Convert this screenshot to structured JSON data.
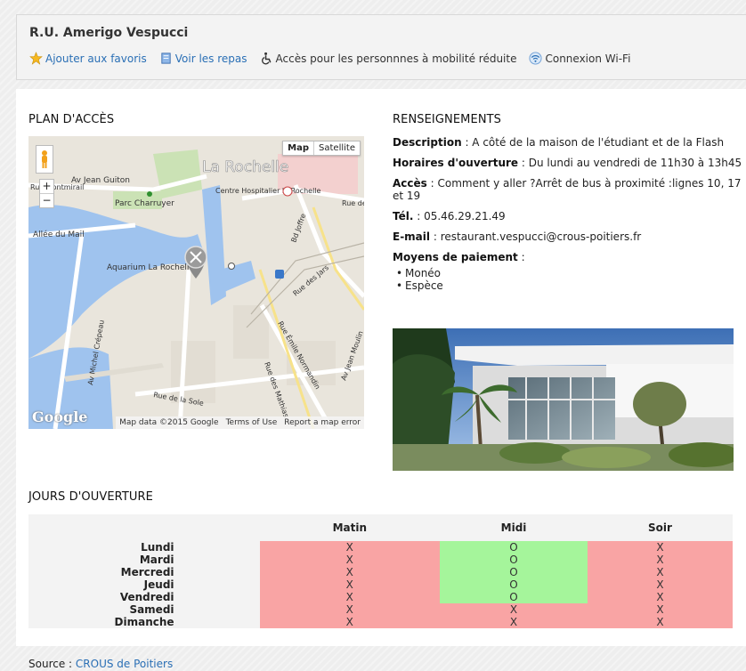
{
  "header": {
    "title": "R.U. Amerigo Vespucci",
    "links": [
      {
        "label": "Ajouter aux favoris",
        "icon": "star-icon",
        "link": true
      },
      {
        "label": "Voir les repas",
        "icon": "book-icon",
        "link": true
      },
      {
        "label": "Accès pour les personnnes à mobilité réduite",
        "icon": "wheelchair-icon",
        "link": false
      },
      {
        "label": "Connexion Wi-Fi",
        "icon": "wifi-icon",
        "link": false
      }
    ]
  },
  "sections": {
    "map_title": "PLAN D'ACCÈS",
    "info_title": "RENSEIGNEMENTS",
    "schedule_title": "JOURS D'OUVERTURE"
  },
  "map": {
    "map_button": "Map",
    "satellite_button": "Satellite",
    "zoom_in": "+",
    "zoom_out": "−",
    "footer": [
      "Map data ©2015 Google",
      "Terms of Use",
      "Report a map error"
    ],
    "logo": "Google",
    "labels": [
      "La Rochelle",
      "Av Jean Guiton",
      "Rue Montmirail",
      "Parc Charruyer",
      "Centre Hospitalier la Rochelle",
      "Allée du Mail",
      "Aquarium La Rochelle",
      "Bd Joffre",
      "Rue des Jars",
      "Av Michel Crépeau",
      "Rue Émile Normandin",
      "Rue des Mathias",
      "Av Jean Moulin",
      "Rue de la Sole",
      "Rue de"
    ]
  },
  "info": {
    "description_label": "Description",
    "description_value": "A côté de la maison de l'étudiant et de la Flash",
    "horaires_label": "Horaires d'ouverture",
    "horaires_value": "Du lundi au vendredi de 11h30 à 13h45",
    "acces_label": "Accès",
    "acces_value": "Comment y aller ?Arrêt de bus à proximité :lignes 10, 17 et 19",
    "tel_label": "Tél.",
    "tel_value": "05.46.29.21.49",
    "email_label": "E-mail",
    "email_value": "restaurant.vespucci@crous-poitiers.fr",
    "paiement_label": "Moyens de paiement",
    "paiement_values": [
      "Monéo",
      "Espèce"
    ]
  },
  "schedule": {
    "columns": [
      "Matin",
      "Midi",
      "Soir"
    ],
    "rows": [
      {
        "day": "Lundi",
        "values": [
          "X",
          "O",
          "X"
        ]
      },
      {
        "day": "Mardi",
        "values": [
          "X",
          "O",
          "X"
        ]
      },
      {
        "day": "Mercredi",
        "values": [
          "X",
          "O",
          "X"
        ]
      },
      {
        "day": "Jeudi",
        "values": [
          "X",
          "O",
          "X"
        ]
      },
      {
        "day": "Vendredi",
        "values": [
          "X",
          "O",
          "X"
        ]
      },
      {
        "day": "Samedi",
        "values": [
          "X",
          "X",
          "X"
        ]
      },
      {
        "day": "Dimanche",
        "values": [
          "X",
          "X",
          "X"
        ]
      }
    ]
  },
  "source": {
    "label": "Source :",
    "link": "CROUS de Poitiers"
  },
  "colors": {
    "closed": "#f9a4a4",
    "open": "#a5f59b",
    "link": "#2a6fb5"
  }
}
